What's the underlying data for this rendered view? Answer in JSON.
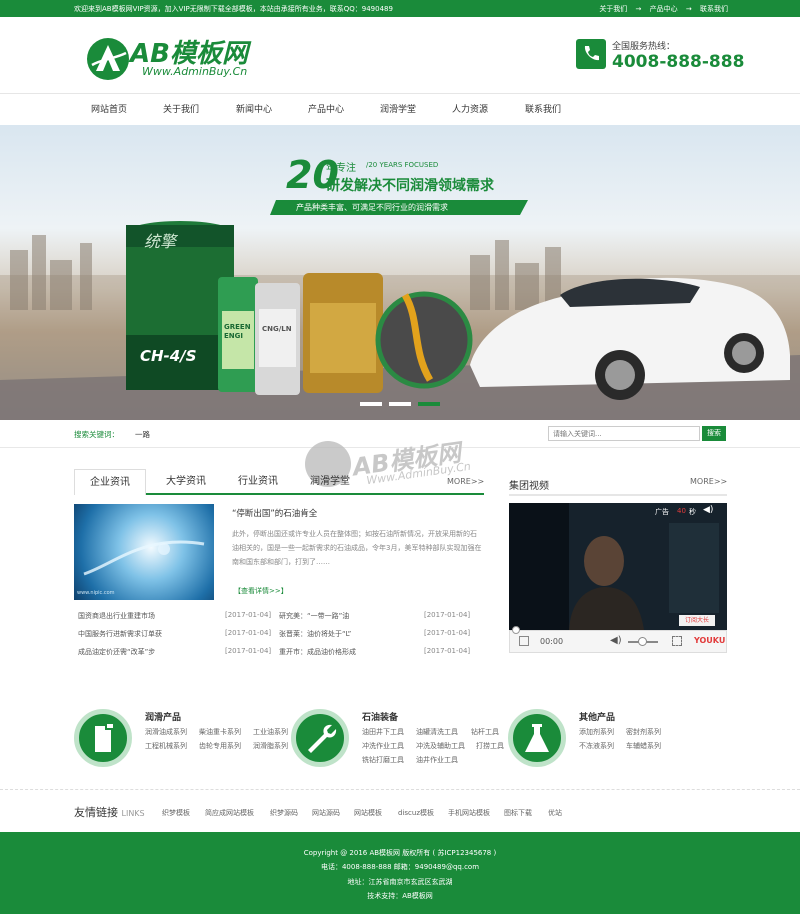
{
  "topbar": {
    "welcome": "欢迎来到AB模板网VIP资源，加入VIP无限制下载全部模板，本站由承接所有业务，联系QQ：9490489",
    "links": [
      "关于我们",
      "→",
      "产品中心",
      "→",
      "联系我们"
    ]
  },
  "header": {
    "logo_title": "AB模板网",
    "logo_url": "Www.AdminBuy.Cn",
    "hotline_label": "全国服务热线：",
    "hotline_number": "4008-888-888"
  },
  "nav": [
    "网站首页",
    "关于我们",
    "新闻中心",
    "产品中心",
    "润滑学堂",
    "人力资源",
    "联系我们"
  ],
  "banner": {
    "big_number": "20",
    "tag_cn": "年专注",
    "tag_en": "/20 YEARS FOCUSED",
    "headline": "研发解决不同润滑领域需求",
    "ribbon": "产品种类丰富、可满足不同行业的润滑需求",
    "bucket_label": "CH-4/S",
    "bucket_brand": "统擎",
    "bottle_label": "GREEN ENGI",
    "can_label": "CNG/LN",
    "active_slide": 3,
    "slide_count": 3
  },
  "search": {
    "label": "搜索关键词：",
    "keyword": "一路",
    "placeholder": "请输入关键词...",
    "button": "搜索"
  },
  "watermark": {
    "title": "AB模板网",
    "url": "Www.AdminBuy.Cn"
  },
  "news": {
    "tabs": [
      "企业资讯",
      "大学资讯",
      "行业资讯",
      "润滑学堂"
    ],
    "more": "MORE>>",
    "image_caption": "www.nipic.com",
    "feature_title": "“停断出国”的石油肯全",
    "feature_desc": "此外，停断出国还或许专业人员在整体图；如按石油所新情况，开放采用新的石油相关的，国是一些一起新需求的石油成品，令年3月，美军特种部队实现加强在南和国东部和部门，打到了……",
    "feature_more": "【查看详情>>】",
    "left_items": [
      {
        "title": "国资商退出行业重建市场",
        "date": "[2017-01-04]"
      },
      {
        "title": "中国服务行进新需求订单获",
        "date": "[2017-01-04]"
      },
      {
        "title": "成品油定价还需“改革”步",
        "date": "[2017-01-04]"
      }
    ],
    "right_items": [
      {
        "title": "研究美：“一带一路”油",
        "date": "[2017-01-04]"
      },
      {
        "title": "张晋莱：油价将处于“L”",
        "date": "[2017-01-04]"
      },
      {
        "title": "重开市：成品油价格形成",
        "date": "[2017-01-04]"
      }
    ]
  },
  "video": {
    "title": "集团视频",
    "more": "MORE>>",
    "ad_label": "广告",
    "countdown": "40",
    "countdown_unit": "秒",
    "time": "00:00",
    "brand": "YOUKU",
    "promo": "订阅大长"
  },
  "products": [
    {
      "title": "润滑产品",
      "links": [
        "润滑油成系列",
        "柴油重卡系列",
        "工业油系列",
        "工程机械系列",
        "齿轮专用系列",
        "润滑脂系列"
      ]
    },
    {
      "title": "石油装备",
      "links": [
        "油田井下工具",
        "油罐清洗工具",
        "钻杆工具",
        "冲洗作业工具",
        "冲洗及辅助工具",
        "打捞工具",
        "铣钻打磨工具",
        "油井作业工具"
      ]
    },
    {
      "title": "其他产品",
      "links": [
        "添加剂系列",
        "密封剂系列",
        "不冻液系列",
        "车辅蜡系列"
      ]
    }
  ],
  "friend_links": {
    "title": "友情链接",
    "title_en": "LINKS",
    "items": [
      "织梦模板",
      "简应成网站模板",
      "织梦源码",
      "网站源码",
      "网站模板",
      "discuz模板",
      "手机网站模板",
      "图标下载",
      "优站"
    ]
  },
  "footer": {
    "copyright": "Copyright @ 2016 AB模板网 版权所有 ( 苏ICP12345678 )",
    "contact": "电话：4008-888-888    邮箱：9490489@qq.com",
    "address": "地址：江苏省南京市玄武区玄武湖",
    "support": "技术支持：AB模板网"
  }
}
